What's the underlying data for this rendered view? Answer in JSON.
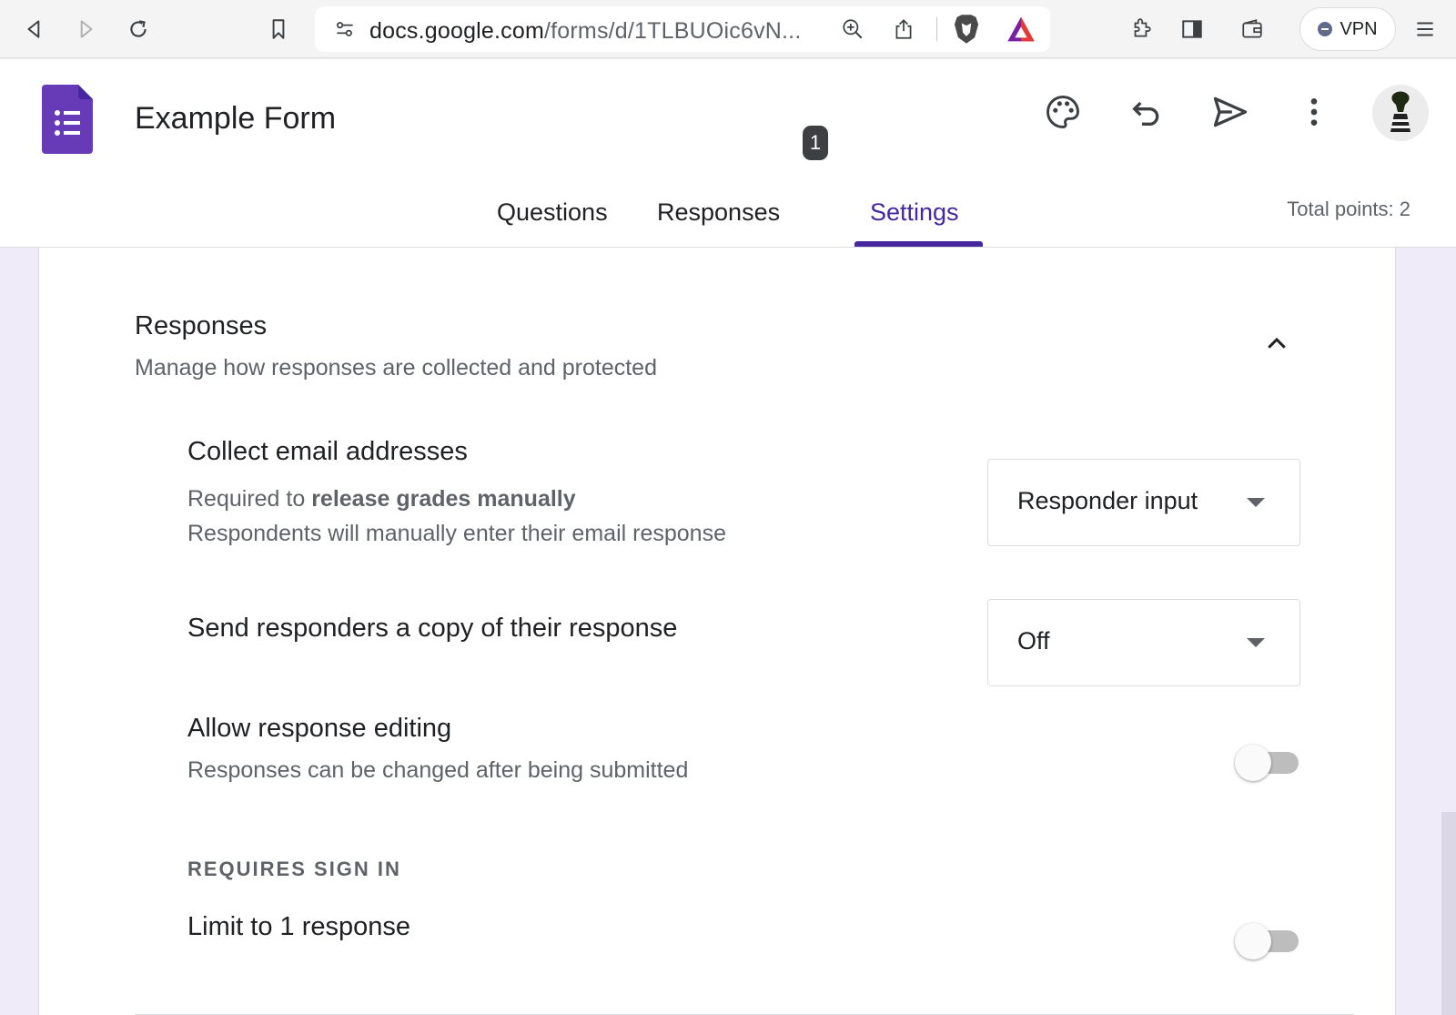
{
  "browser": {
    "url_host": "docs.google.com",
    "url_path": "/forms/d/1TLBUOic6vN...",
    "vpn_label": "VPN"
  },
  "header": {
    "form_title": "Example Form",
    "total_points": "Total points: 2"
  },
  "tabs": [
    {
      "label": "Questions"
    },
    {
      "label": "Responses",
      "badge": "1"
    },
    {
      "label": "Settings",
      "active": true
    }
  ],
  "section": {
    "title": "Responses",
    "subtitle": "Manage how responses are collected and protected"
  },
  "settings": {
    "collect_email": {
      "title": "Collect email addresses",
      "desc_prefix": "Required to ",
      "desc_bold": "release grades manually",
      "desc2": "Respondents will manually enter their email response",
      "value": "Responder input"
    },
    "send_copy": {
      "title": "Send responders a copy of their response",
      "value": "Off"
    },
    "allow_editing": {
      "title": "Allow response editing",
      "desc": "Responses can be changed after being submitted",
      "enabled": false
    },
    "requires_sign_in": "REQUIRES SIGN IN",
    "limit_one": {
      "title": "Limit to 1 response",
      "enabled": false
    }
  },
  "colors": {
    "accent": "#4527a0",
    "forms_brand": "#673ab7",
    "page_bg": "#f0ebf8"
  },
  "icons": [
    "back-icon",
    "forward-icon",
    "reload-icon",
    "bookmark-icon",
    "site-settings-icon",
    "zoom-icon",
    "share-icon",
    "brave-shield-icon",
    "brave-rewards-icon",
    "extensions-icon",
    "sidebar-icon",
    "wallet-icon",
    "menu-icon",
    "palette-icon",
    "undo-icon",
    "send-icon",
    "more-vert-icon",
    "chevron-up-icon",
    "dropdown-arrow-icon"
  ]
}
